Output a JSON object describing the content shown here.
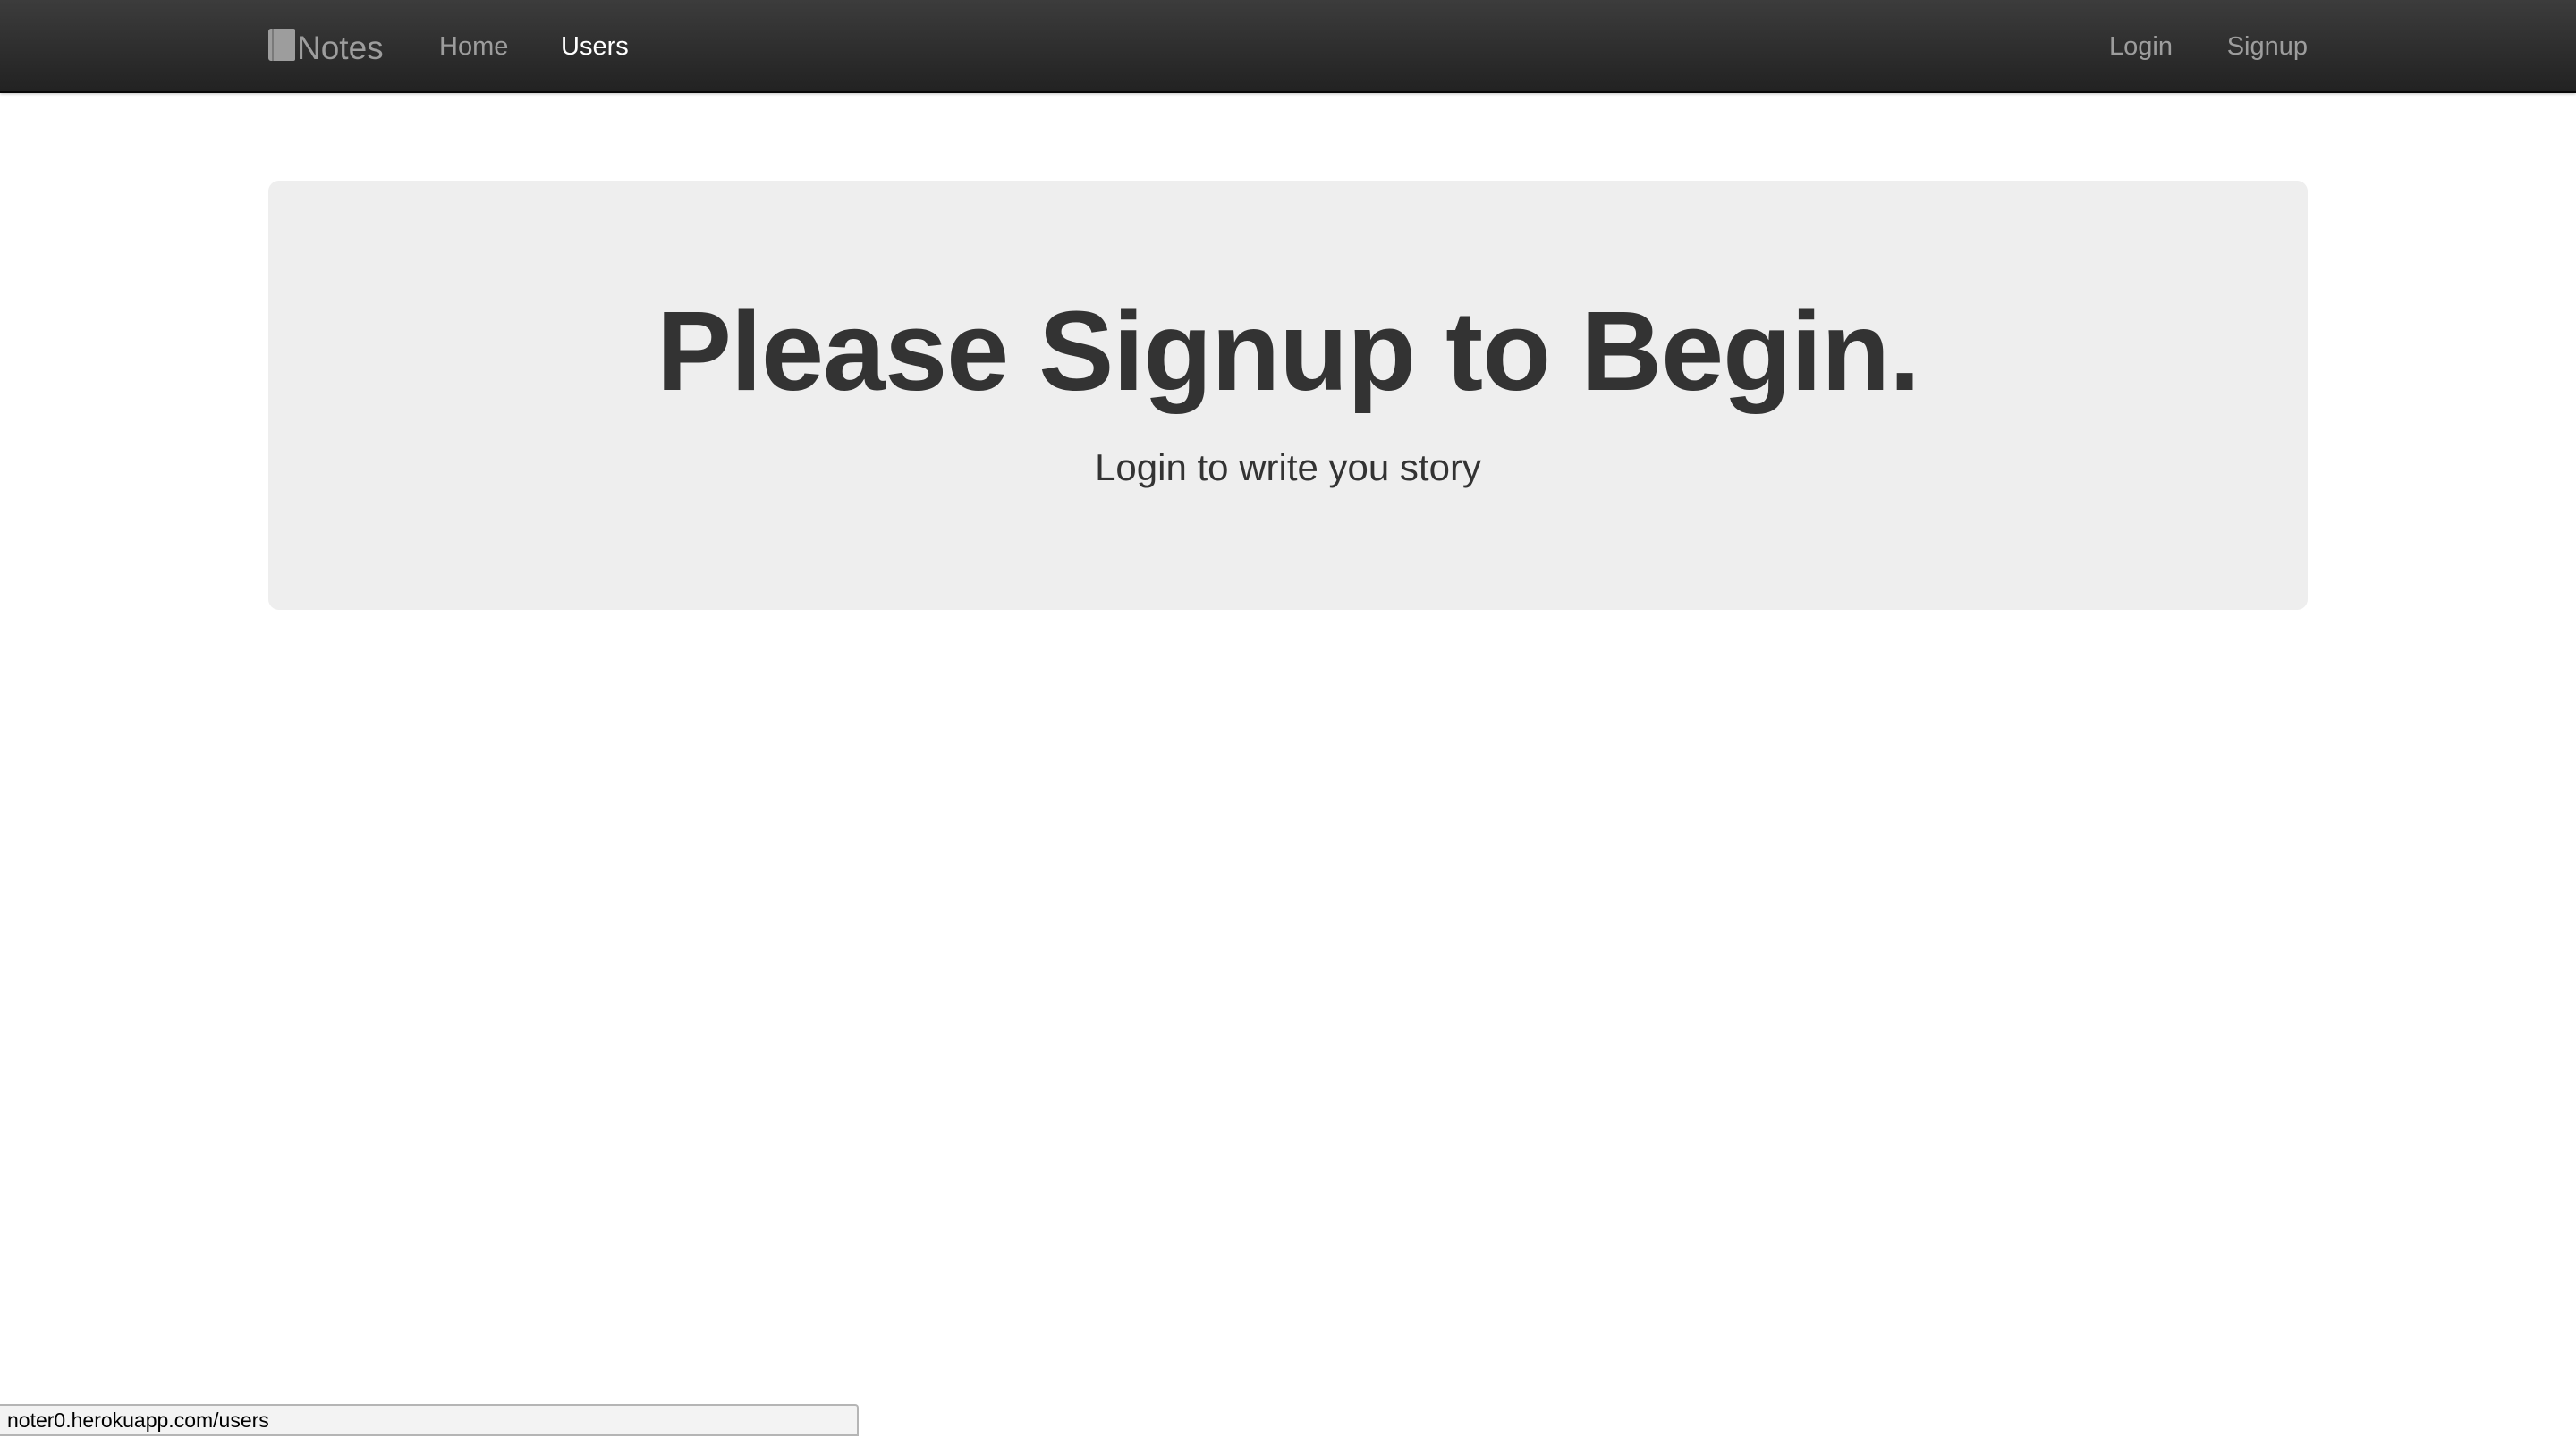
{
  "navbar": {
    "brand": {
      "icon": "book-icon",
      "label": "Notes"
    },
    "left_links": [
      {
        "label": "Home",
        "active": false
      },
      {
        "label": "Users",
        "active": true
      }
    ],
    "right_links": [
      {
        "label": "Login"
      },
      {
        "label": "Signup"
      }
    ],
    "colors": {
      "background": "#222222",
      "link": "#9d9d9d",
      "active_link": "#ffffff"
    }
  },
  "jumbotron": {
    "title": "Please Signup to Begin.",
    "subtitle": "Login to write you story",
    "background": "#eeeeee"
  },
  "status_bar": {
    "url": "noter0.herokuapp.com/users"
  }
}
